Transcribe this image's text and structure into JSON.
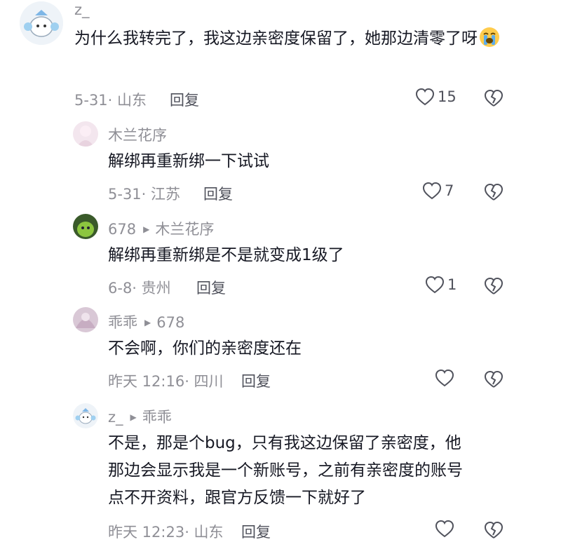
{
  "comments": [
    {
      "user": "z_",
      "text": "为什么我转完了，我这边亲密度保留了，她那边清零了呀",
      "emoji": "loudly-crying-face",
      "date_loc": "5-31· 山东",
      "reply_label": "回复",
      "likes": "15"
    },
    {
      "user": "木兰花序",
      "text": "解绑再重新绑一下试试",
      "date_loc": "5-31· 江苏",
      "reply_label": "回复",
      "likes": "7"
    },
    {
      "user": "678",
      "reply_to": "木兰花序",
      "text": "解绑再重新绑是不是就变成1级了",
      "date_loc": "6-8· 贵州",
      "reply_label": "回复",
      "likes": "1"
    },
    {
      "user": "乖乖",
      "reply_to": "678",
      "text": "不会啊，你们的亲密度还在",
      "date_loc": "昨天 12:16· 四川",
      "reply_label": "回复",
      "likes": ""
    },
    {
      "user": "z_",
      "reply_to": "乖乖",
      "text_lines": [
        "不是，那是个bug，只有我这边保留了亲密度，他",
        "那边会显示我是一个新账号，之前有亲密度的账号",
        "点不开资料，跟官方反馈一下就好了"
      ],
      "date_loc": "昨天 12:23· 山东",
      "reply_label": "回复"
    }
  ],
  "icons": {
    "like": "heart-outline-icon",
    "dislike": "broken-heart-icon",
    "reply_arrow": "play-triangle-icon"
  }
}
